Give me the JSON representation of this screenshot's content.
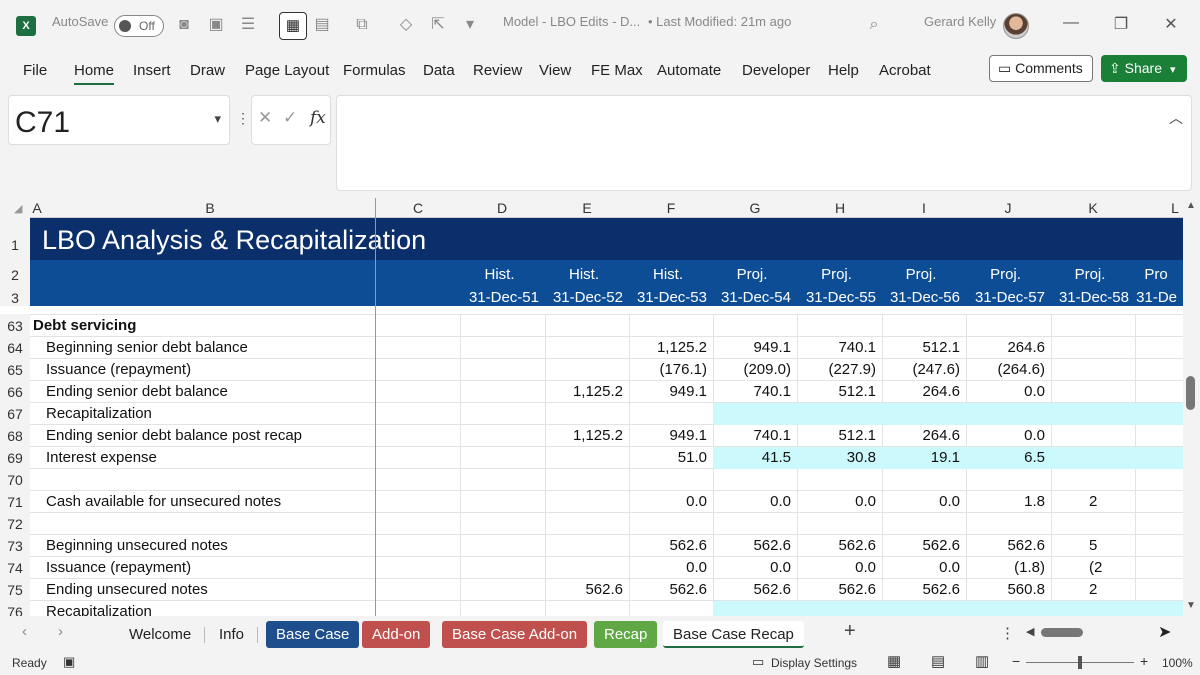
{
  "titlebar": {
    "app_logo": "X",
    "autosave_label": "AutoSave",
    "autosave_state": "Off",
    "doc_title": "Model - LBO Edits - D...",
    "last_modified": "• Last Modified: 21m ago",
    "user_name": "Gerard Kelly",
    "icons": [
      "camera-icon",
      "pictures-icon",
      "align-icon",
      "table-icon",
      "form-icon",
      "shapes-icon",
      "eraser-icon",
      "share-screen-icon",
      "customize-icon",
      "search-icon"
    ]
  },
  "menu": {
    "items": [
      "File",
      "Home",
      "Insert",
      "Draw",
      "Page Layout",
      "Formulas",
      "Data",
      "Review",
      "View",
      "FE Max",
      "Automate",
      "Developer",
      "Help",
      "Acrobat"
    ],
    "active": "Home",
    "comments_label": "Comments",
    "share_label": "Share"
  },
  "formula_bar": {
    "name_box": "C71",
    "fx_label": "fx",
    "formula": ""
  },
  "sheet": {
    "columns": [
      "A",
      "B",
      "C",
      "D",
      "E",
      "F",
      "G",
      "H",
      "I",
      "J",
      "K",
      "L"
    ],
    "title": "LBO Analysis & Recapitalization",
    "header_row2": [
      "Hist.",
      "Hist.",
      "Hist.",
      "Proj.",
      "Proj.",
      "Proj.",
      "Proj.",
      "Proj.",
      "Pro"
    ],
    "header_row3": [
      "31-Dec-51",
      "31-Dec-52",
      "31-Dec-53",
      "31-Dec-54",
      "31-Dec-55",
      "31-Dec-56",
      "31-Dec-57",
      "31-Dec-58",
      "31-De"
    ],
    "row_headers_top": [
      "1",
      "2",
      "3"
    ],
    "rows": [
      {
        "n": "63",
        "label": "Debt servicing",
        "bold": true,
        "vals": [
          "",
          "",
          "",
          "",
          "",
          "",
          "",
          "",
          ""
        ]
      },
      {
        "n": "64",
        "label": "Beginning senior debt balance",
        "vals": [
          "",
          "",
          "",
          "1,125.2",
          "949.1",
          "740.1",
          "512.1",
          "264.6",
          ""
        ]
      },
      {
        "n": "65",
        "label": "Issuance (repayment)",
        "vals": [
          "",
          "",
          "",
          "(176.1)",
          "(209.0)",
          "(227.9)",
          "(247.6)",
          "(264.6)",
          ""
        ]
      },
      {
        "n": "66",
        "label": "Ending senior debt balance",
        "vals": [
          "",
          "",
          "1,125.2",
          "949.1",
          "740.1",
          "512.1",
          "264.6",
          "0.0",
          ""
        ]
      },
      {
        "n": "67",
        "label": "Recapitalization",
        "vals": [
          "",
          "",
          "",
          "",
          "",
          "",
          "",
          "",
          ""
        ],
        "cyan": true
      },
      {
        "n": "68",
        "label": "Ending senior debt balance post recap",
        "vals": [
          "",
          "",
          "1,125.2",
          "949.1",
          "740.1",
          "512.1",
          "264.6",
          "0.0",
          ""
        ]
      },
      {
        "n": "69",
        "label": "Interest expense",
        "vals": [
          "",
          "",
          "",
          "51.0",
          "41.5",
          "30.8",
          "19.1",
          "6.5",
          ""
        ],
        "cyan": true
      },
      {
        "n": "70",
        "label": "",
        "vals": [
          "",
          "",
          "",
          "",
          "",
          "",
          "",
          "",
          ""
        ]
      },
      {
        "n": "71",
        "label": "Cash available for unsecured notes",
        "vals": [
          "",
          "",
          "",
          "0.0",
          "0.0",
          "0.0",
          "0.0",
          "1.8",
          "2"
        ]
      },
      {
        "n": "72",
        "label": "",
        "vals": [
          "",
          "",
          "",
          "",
          "",
          "",
          "",
          "",
          ""
        ]
      },
      {
        "n": "73",
        "label": "Beginning unsecured notes",
        "vals": [
          "",
          "",
          "",
          "562.6",
          "562.6",
          "562.6",
          "562.6",
          "562.6",
          "5"
        ]
      },
      {
        "n": "74",
        "label": "Issuance (repayment)",
        "vals": [
          "",
          "",
          "",
          "0.0",
          "0.0",
          "0.0",
          "0.0",
          "(1.8)",
          "(2"
        ]
      },
      {
        "n": "75",
        "label": "Ending unsecured notes",
        "vals": [
          "",
          "",
          "562.6",
          "562.6",
          "562.6",
          "562.6",
          "562.6",
          "560.8",
          "2"
        ]
      },
      {
        "n": "76",
        "label": "Recapitalization",
        "vals": [
          "",
          "",
          "",
          "",
          "",
          "",
          "",
          "",
          ""
        ],
        "cyan": true
      }
    ]
  },
  "tabs": [
    {
      "label": "Welcome",
      "style": "plain"
    },
    {
      "label": "Info",
      "style": "plain"
    },
    {
      "label": "Base Case",
      "style": "blue"
    },
    {
      "label": "Add-on",
      "style": "red"
    },
    {
      "label": "Base Case Add-on",
      "style": "red"
    },
    {
      "label": "Recap",
      "style": "green"
    },
    {
      "label": "Base Case Recap",
      "style": "active"
    }
  ],
  "tab_add": "+",
  "status": {
    "ready": "Ready",
    "display_settings": "Display Settings",
    "zoom": "100%",
    "zoom_level": 1.0
  },
  "colors": {
    "title_band": "#0b2f6b",
    "header_band": "#0d4d96",
    "cyan_fill": "#ccf9fb",
    "excel_green": "#1d6f42"
  }
}
